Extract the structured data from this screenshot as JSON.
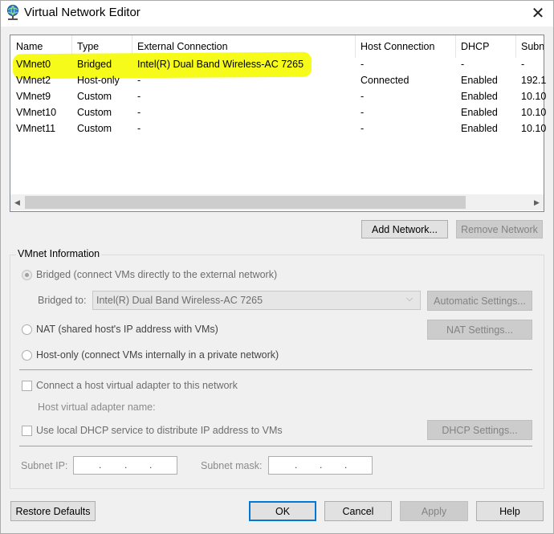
{
  "window": {
    "title": "Virtual Network Editor"
  },
  "table": {
    "columns": [
      "Name",
      "Type",
      "External Connection",
      "Host Connection",
      "DHCP",
      "Subn"
    ],
    "rows": [
      [
        "VMnet0",
        "Bridged",
        "Intel(R) Dual Band Wireless-AC 7265",
        "-",
        "-",
        "-"
      ],
      [
        "VMnet2",
        "Host-only",
        "-",
        "Connected",
        "Enabled",
        "192.1"
      ],
      [
        "VMnet9",
        "Custom",
        "-",
        "-",
        "Enabled",
        "10.10"
      ],
      [
        "VMnet10",
        "Custom",
        "-",
        "-",
        "Enabled",
        "10.10"
      ],
      [
        "VMnet11",
        "Custom",
        "-",
        "-",
        "Enabled",
        "10.10"
      ]
    ]
  },
  "list_buttons": {
    "add": "Add Network...",
    "remove": "Remove Network"
  },
  "vmnet_info": {
    "group_label": "VMnet Information",
    "bridged_label": "Bridged (connect VMs directly to the external network)",
    "bridged_to_label": "Bridged to:",
    "bridged_to_value": "Intel(R) Dual Band Wireless-AC 7265",
    "automatic_settings": "Automatic Settings...",
    "nat_label": "NAT (shared host's IP address with VMs)",
    "nat_settings": "NAT Settings...",
    "hostonly_label": "Host-only (connect VMs internally in a private network)",
    "connect_adapter_label": "Connect a host virtual adapter to this network",
    "adapter_name_label": "Host virtual adapter name:",
    "dhcp_label": "Use local DHCP service to distribute IP address to VMs",
    "dhcp_settings": "DHCP Settings...",
    "subnet_ip_label": "Subnet IP:",
    "subnet_mask_label": "Subnet mask:"
  },
  "footer": {
    "restore": "Restore Defaults",
    "ok": "OK",
    "cancel": "Cancel",
    "apply": "Apply",
    "help": "Help"
  },
  "colors": {
    "highlight": "#f7fb1a",
    "accent": "#0078d7"
  },
  "icons": {
    "app": "network-globe-icon",
    "close": "close-icon"
  }
}
